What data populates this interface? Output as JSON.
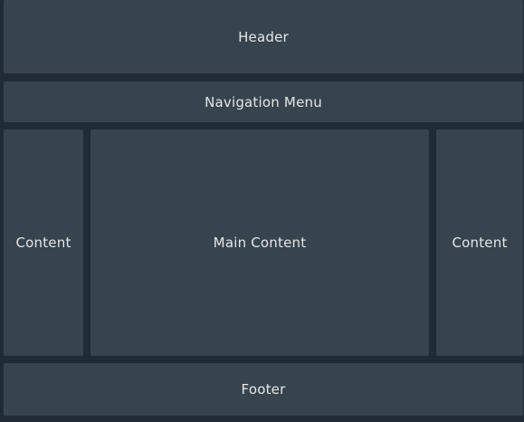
{
  "layout": {
    "header": {
      "label": "Header"
    },
    "navigation": {
      "label": "Navigation Menu"
    },
    "content": {
      "left_label": "Content",
      "main_label": "Main Content",
      "right_label": "Content"
    },
    "footer": {
      "label": "Footer"
    }
  },
  "theme": {
    "background_color": "#202b36",
    "panel_color": "#37444e",
    "text_color": "#e6e6e6"
  }
}
